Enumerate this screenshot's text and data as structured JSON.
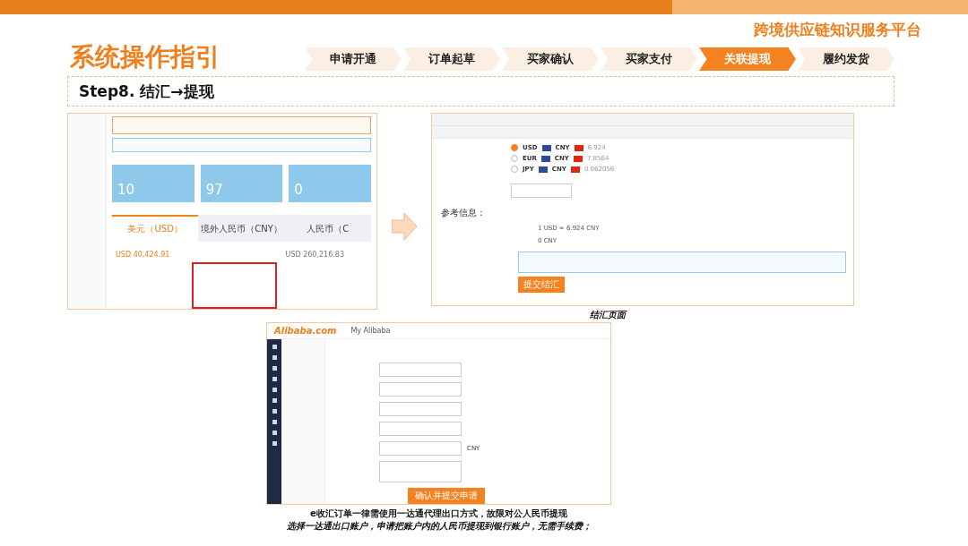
{
  "header": {
    "title": "系统操作指引",
    "platform": "跨境供应链知识服务平台"
  },
  "steps": [
    {
      "label": "申请开通",
      "selected": false
    },
    {
      "label": "订单起草",
      "selected": false
    },
    {
      "label": "买家确认",
      "selected": false
    },
    {
      "label": "买家支付",
      "selected": false
    },
    {
      "label": "关联提现",
      "selected": true
    },
    {
      "label": "履约发货",
      "selected": false
    }
  ],
  "step_heading": "Step8. 结汇→提现",
  "account_screen": {
    "cards": [
      {
        "value": "10"
      },
      {
        "value": "97"
      },
      {
        "value": "0"
      }
    ],
    "tabs": [
      {
        "label": "美元（USD）",
        "selected": true
      },
      {
        "label": "境外人民币（CNY）",
        "selected": false
      },
      {
        "label": "人民币（C",
        "selected": false
      }
    ],
    "available": "USD 40,424.91",
    "unavailable": "USD 260,216.83"
  },
  "exchange_screen": {
    "rates": [
      {
        "from": "USD",
        "to": "CNY",
        "rate": "6.924",
        "selected": true
      },
      {
        "from": "EUR",
        "to": "CNY",
        "rate": "7.8564",
        "selected": false
      },
      {
        "from": "JPY",
        "to": "CNY",
        "rate": "0.062056",
        "selected": false
      }
    ],
    "reference_title": "参考信息：",
    "reference_rate": "1 USD = 6.924 CNY",
    "reference_amount": "0 CNY",
    "submit": "提交结汇"
  },
  "exchange_caption": "结汇页面",
  "withdraw_screen": {
    "logo": "Alibaba.com",
    "title": "My Alibaba",
    "currency": "CNY",
    "submit": "确认并提交申请"
  },
  "captions": [
    "e收汇订单一律需使用一达通代理出口方式，故限对公人民币提现",
    "选择一达通出口账户，申请把账户内的人民币提现到银行账户，无需手续费；"
  ]
}
